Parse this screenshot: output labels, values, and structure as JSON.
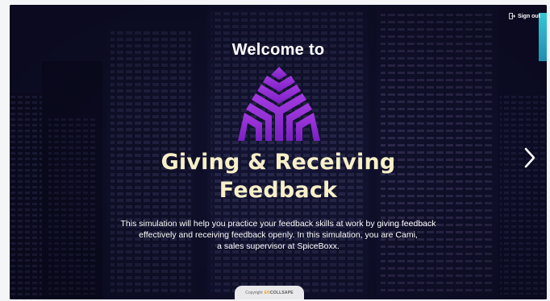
{
  "header": {
    "signout_label": "Sign out"
  },
  "hero": {
    "welcome": "Welcome to",
    "title_line1": "Giving & Receiving",
    "title_line2": "Feedback",
    "description_line1": "This simulation will help you practice your feedback skills at work by giving feedback",
    "description_line2": "effectively and receiving feedback openly. In this simulation, you are Cami,",
    "description_line3": "a sales supervisor at SpiceBoxx."
  },
  "footer": {
    "copyright_label": "Copyright",
    "brand_prefix": "EN",
    "brand_suffix": "COLLSAPE"
  },
  "icons": {
    "signout": "sign-out-icon",
    "next": "chevron-right-icon",
    "logo": "triangle-logo-icon"
  },
  "colors": {
    "title": "#f7f0c8",
    "logo_purple": "#9b2fd8",
    "background": "#121535",
    "accent": "#36c7d6"
  }
}
